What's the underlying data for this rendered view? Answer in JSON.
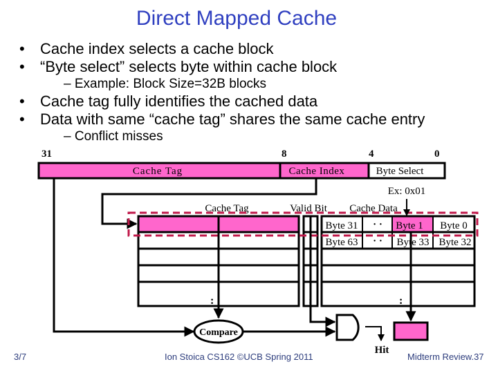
{
  "slide": {
    "title": "Direct Mapped Cache",
    "bullets": [
      {
        "level": 1,
        "marker": "•",
        "text": "Cache index selects a cache block"
      },
      {
        "level": 1,
        "marker": "•",
        "text": "“Byte select” selects byte within cache block"
      },
      {
        "level": 2,
        "marker": "–",
        "text": "– Example: Block Size=32B blocks"
      },
      {
        "level": 1,
        "marker": "•",
        "text": "Cache tag fully identifies the cached data"
      },
      {
        "level": 1,
        "marker": "•",
        "text": "Data with same “cache tag” shares the same cache entry"
      },
      {
        "level": 2,
        "marker": "–",
        "text": "– Conflict misses"
      }
    ]
  },
  "address": {
    "bit_labels": {
      "msb": "31",
      "index_hi": "8",
      "index_lo": "4",
      "lsb": "0"
    },
    "fields": {
      "tag": "Cache Tag",
      "index": "Cache Index",
      "byte_select": "Byte Select"
    },
    "example": "Ex: 0x01"
  },
  "cache": {
    "column_headers": {
      "tag": "Cache Tag",
      "valid": "Valid Bit",
      "data": "Cache Data"
    },
    "rows": [
      {
        "bytes": [
          "Byte 31",
          "· ·",
          "Byte 1",
          "Byte 0"
        ],
        "selected": true
      },
      {
        "bytes": [
          "Byte 63",
          "· ·",
          "Byte 33",
          "Byte 32"
        ],
        "selected": false
      }
    ],
    "ellipsis": ":",
    "colors": {
      "highlight": "#ff66cc",
      "selection_border": "#c0184a"
    }
  },
  "logic": {
    "compare_label": "Compare",
    "hit_label": "Hit"
  },
  "footer": {
    "left": "3/7",
    "center": "Ion Stoica CS162 ©UCB Spring 2011",
    "right": "Midterm Review.37"
  }
}
